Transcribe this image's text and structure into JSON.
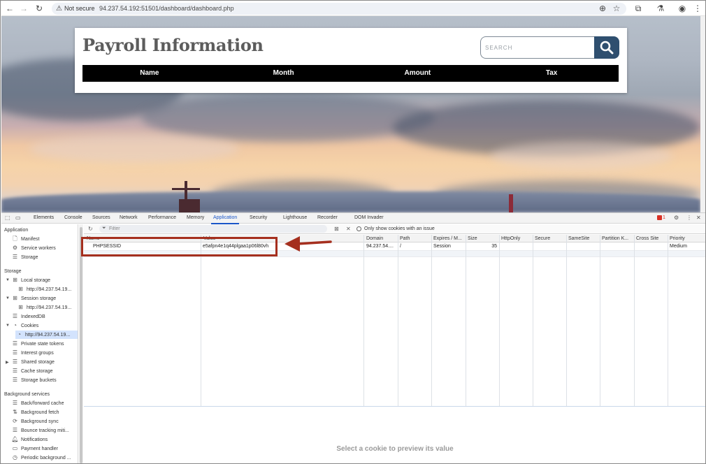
{
  "browser": {
    "security_label": "Not secure",
    "url": "94.237.54.192:51501/dashboard/dashboard.php"
  },
  "page": {
    "title": "Payroll Information",
    "search_placeholder": "SEARCH",
    "table_headers": [
      "Name",
      "Month",
      "Amount",
      "Tax"
    ]
  },
  "devtools": {
    "tabs": [
      "Elements",
      "Console",
      "Sources",
      "Network",
      "Performance",
      "Memory",
      "Application",
      "Security",
      "Lighthouse",
      "Recorder",
      "DOM Invader"
    ],
    "active_tab": "Application",
    "issues_count": "1",
    "sidebar": {
      "application_header": "Application",
      "application_items": [
        "Manifest",
        "Service workers",
        "Storage"
      ],
      "storage_header": "Storage",
      "local_storage": "Local storage",
      "local_storage_origin": "http://94.237.54.19...",
      "session_storage": "Session storage",
      "session_storage_origin": "http://94.237.54.19...",
      "indexeddb": "IndexedDB",
      "cookies": "Cookies",
      "cookies_origin": "http://94.237.54.19...",
      "storage_items": [
        "Private state tokens",
        "Interest groups",
        "Shared storage",
        "Cache storage",
        "Storage buckets"
      ],
      "background_header": "Background services",
      "background_items": [
        "Back/forward cache",
        "Background fetch",
        "Background sync",
        "Bounce tracking miti...",
        "Notifications",
        "Payment handler",
        "Periodic background ..."
      ]
    },
    "filter_placeholder": "Filter",
    "only_issues_label": "Only show cookies with an issue",
    "columns": [
      "Name",
      "Value",
      "Domain",
      "Path",
      "Expires / M...",
      "Size",
      "HttpOnly",
      "Secure",
      "SameSite",
      "Partition K...",
      "Cross Site",
      "Priority"
    ],
    "cookie": {
      "name": "PHPSESSID",
      "value": "e5afpn4e1q44plgaa1p06l80vh",
      "domain": "94.237.54....",
      "path": "/",
      "expires": "Session",
      "size": "35",
      "priority": "Medium"
    },
    "preview_text": "Select a cookie to preview its value"
  },
  "colors": {
    "annotation": "#a52f1e",
    "devtools_accent": "#1a56c8",
    "search_button": "#2f4f6f"
  }
}
